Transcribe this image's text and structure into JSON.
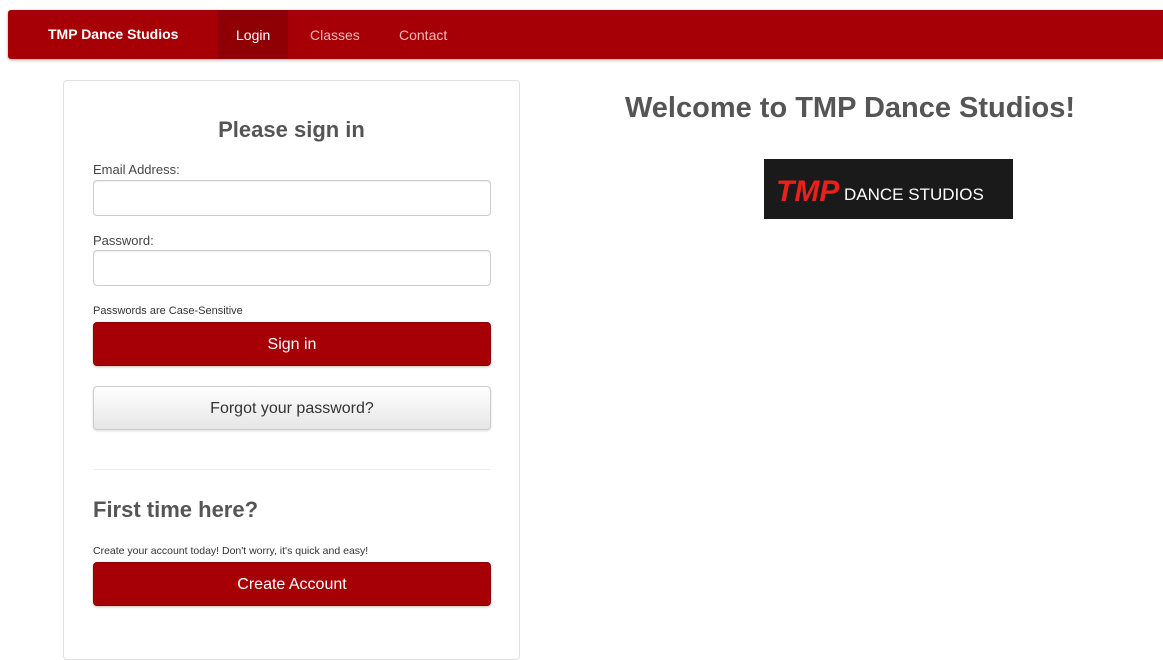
{
  "navbar": {
    "brand": "TMP Dance Studios",
    "items": [
      {
        "label": "Login",
        "active": true
      },
      {
        "label": "Classes",
        "active": false
      },
      {
        "label": "Contact",
        "active": false
      }
    ]
  },
  "signin": {
    "title": "Please sign in",
    "email_label": "Email Address:",
    "email_value": "",
    "password_label": "Password:",
    "password_value": "",
    "case_note": "Passwords are Case-Sensitive",
    "signin_button": "Sign in",
    "forgot_button": "Forgot your password?"
  },
  "register": {
    "title": "First time here?",
    "description": "Create your account today! Don't worry, it's quick and easy!",
    "create_button": "Create Account"
  },
  "welcome": {
    "title": "Welcome to TMP Dance Studios!",
    "logo_mark": "TMP",
    "logo_text": "DANCE STUDIOS"
  },
  "colors": {
    "brand_red": "#a60006",
    "text_gray": "#555555",
    "logo_bg": "#1a1a1a"
  }
}
